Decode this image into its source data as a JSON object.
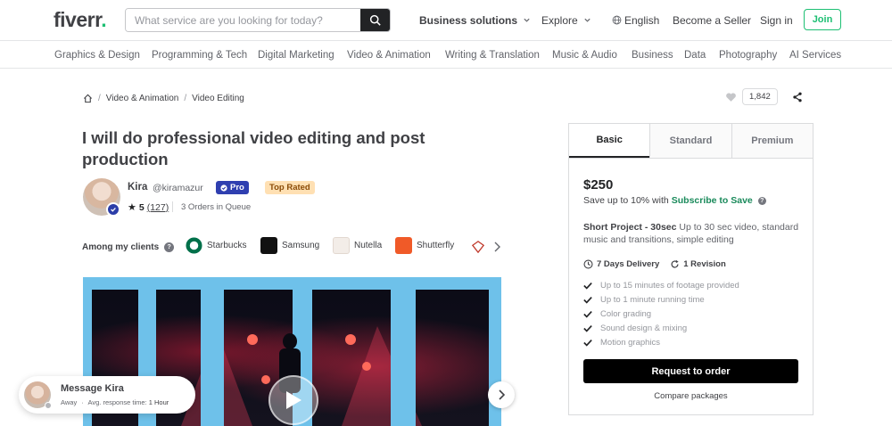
{
  "header": {
    "logo_text": "fiverr",
    "logo_dot": ".",
    "search_placeholder": "What service are you looking for today?",
    "nav": {
      "business_solutions": "Business solutions",
      "explore": "Explore",
      "language": "English",
      "become_seller": "Become a Seller",
      "sign_in": "Sign in",
      "join": "Join"
    }
  },
  "categories": [
    "Graphics & Design",
    "Programming & Tech",
    "Digital Marketing",
    "Video & Animation",
    "Writing & Translation",
    "Music & Audio",
    "Business",
    "Data",
    "Photography",
    "AI Services"
  ],
  "breadcrumb": {
    "level1": "Video & Animation",
    "level2": "Video Editing",
    "separator": "/"
  },
  "favorites_count": "1,842",
  "gig": {
    "title": "I will do professional video editing and post production",
    "seller_name": "Kira",
    "seller_handle": "@kiramazur",
    "pro_badge": "Pro",
    "top_rated_badge": "Top Rated",
    "rating": "5",
    "reviews": "(127)",
    "orders_in_queue": "3 Orders in Queue"
  },
  "clients": {
    "label": "Among my clients",
    "items": [
      {
        "name": "Starbucks",
        "color": "#00704A"
      },
      {
        "name": "Samsung",
        "color": "#111111"
      },
      {
        "name": "Nutella",
        "color": "#5a3a2e"
      },
      {
        "name": "Shutterfly",
        "color": "#f05a28"
      }
    ]
  },
  "message": {
    "title": "Message Kira",
    "status": "Away",
    "response_label": "Avg. response time:",
    "response_time": "1 Hour",
    "separator": "·"
  },
  "pricing": {
    "tabs": [
      "Basic",
      "Standard",
      "Premium"
    ],
    "active_tab": "Basic",
    "price": "$250",
    "save_text": "Save up to 10% with",
    "subscribe_text": "Subscribe to Save",
    "package_name": "Short Project - 30sec",
    "package_desc": "Up to 30 sec video, standard music and transitions, simple editing",
    "delivery": "7 Days Delivery",
    "revisions": "1 Revision",
    "features": [
      "Up to 15 minutes of footage provided",
      "Up to 1 minute running time",
      "Color grading",
      "Sound design & mixing",
      "Motion graphics"
    ],
    "order_button": "Request to order",
    "compare_link": "Compare packages"
  },
  "colors": {
    "brand_green": "#1dbf73",
    "pro_blue": "#2f3fb0",
    "top_rated_bg": "#ffe0b3"
  }
}
